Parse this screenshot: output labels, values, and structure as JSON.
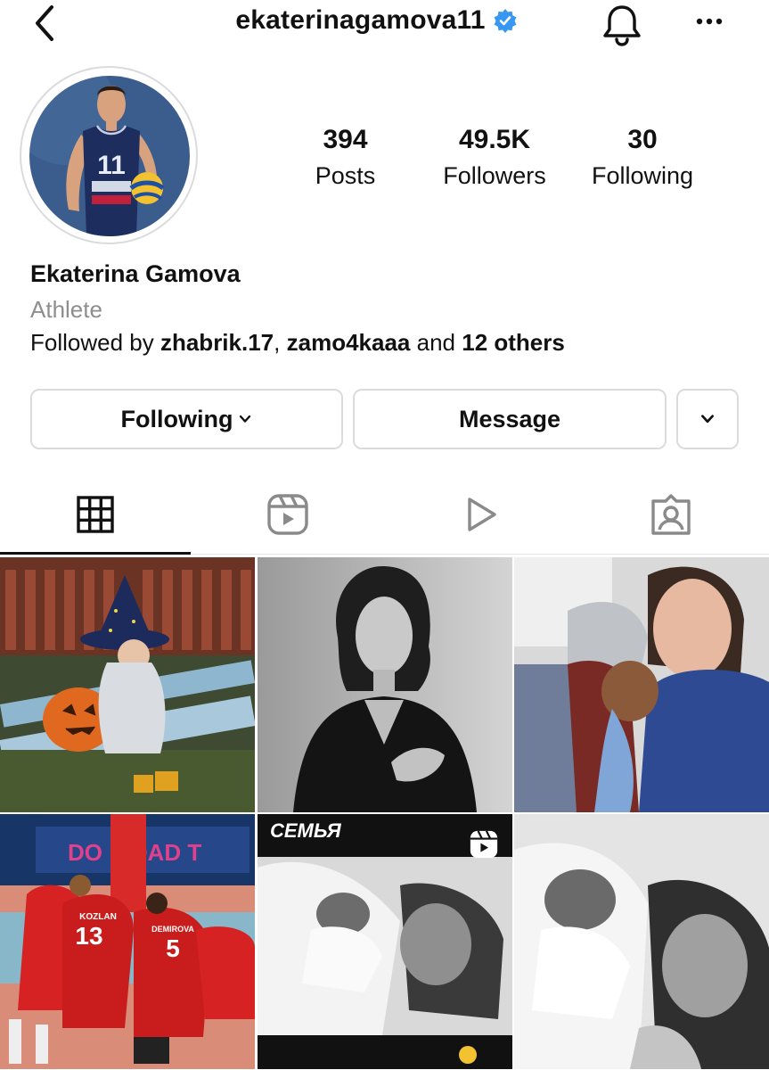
{
  "header": {
    "username": "ekaterinagamova11",
    "verified": true,
    "icons": [
      "back-arrow-icon",
      "verified-badge-icon",
      "bell-icon",
      "more-options-icon"
    ]
  },
  "stats": [
    {
      "value": "394",
      "label": "Posts"
    },
    {
      "value": "49.5K",
      "label": "Followers"
    },
    {
      "value": "30",
      "label": "Following"
    }
  ],
  "bio": {
    "name": "Ekaterina Gamova",
    "category": "Athlete",
    "followed_prefix": "Followed by",
    "followed_user1": "zhabrik.17",
    "followed_sep": ",",
    "followed_user2": "zamo4kaaa",
    "followed_and": "and",
    "followed_others": "12 others"
  },
  "buttons": {
    "following_label": "Following",
    "message_label": "Message"
  },
  "avatar_jersey_number": "11",
  "tabs": [
    "grid-icon",
    "reels-icon",
    "video-play-icon",
    "tagged-icon"
  ],
  "posts": [
    {
      "kind": "image",
      "subject": "child in witch costume with pumpkin"
    },
    {
      "kind": "image",
      "subject": "black and white portrait"
    },
    {
      "kind": "image",
      "subject": "mother with child"
    },
    {
      "kind": "image",
      "subject": "volleyball team huddle",
      "texts": {
        "banner": "DO      ILOAD T",
        "n1": "13",
        "n1name": "KOZLAN",
        "n2": "5",
        "n2name": "DEMIROVA"
      }
    },
    {
      "kind": "reel",
      "subject": "newborn with mother",
      "texts": {
        "caption": "СЕМЬЯ"
      }
    },
    {
      "kind": "image",
      "subject": "newborn with mother"
    }
  ],
  "colors": {
    "accent": "#3897f0",
    "border": "#dbdbdb",
    "muted": "#8e8e8e"
  }
}
